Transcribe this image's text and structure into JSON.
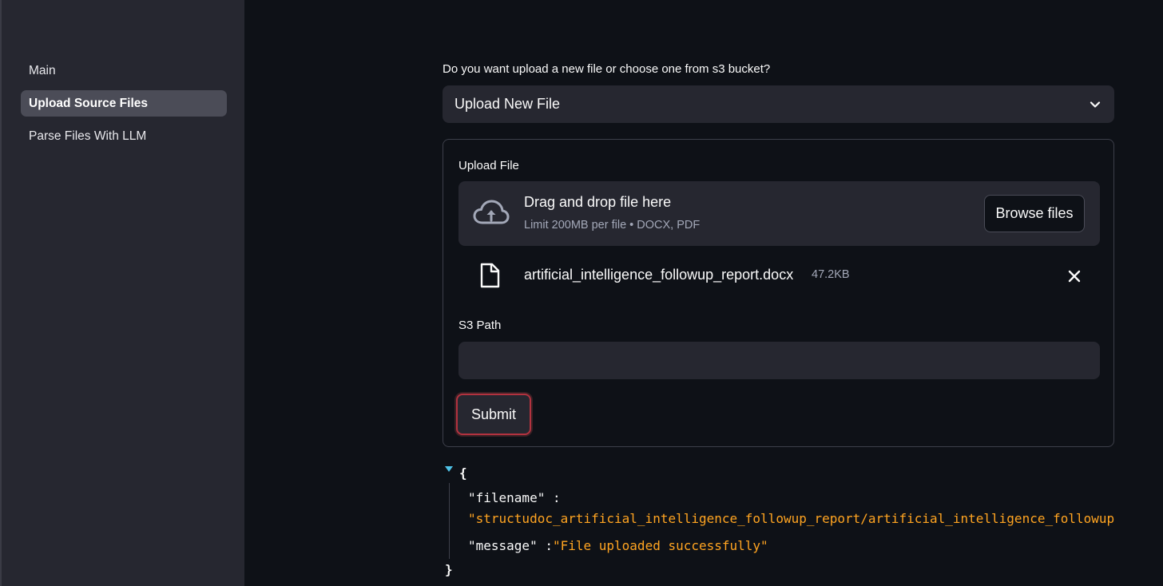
{
  "sidebar": {
    "items": [
      {
        "label": "Main",
        "active": false
      },
      {
        "label": "Upload Source Files",
        "active": true
      },
      {
        "label": "Parse Files With LLM",
        "active": false
      }
    ]
  },
  "main": {
    "question": "Do you want upload a new file or choose one from s3 bucket?",
    "select": {
      "value": "Upload New File",
      "icon": "chevron-down-icon"
    },
    "form": {
      "upload_label": "Upload File",
      "dropzone": {
        "title": "Drag and drop file here",
        "subtitle": "Limit 200MB per file • DOCX, PDF",
        "browse_label": "Browse files",
        "icon": "cloud-upload-icon"
      },
      "file": {
        "name": "artificial_intelligence_followup_report.docx",
        "size": "47.2KB",
        "icon": "file-icon"
      },
      "s3_label": "S3 Path",
      "s3_value": "",
      "submit_label": "Submit"
    },
    "json": {
      "open": "{",
      "close": "}",
      "filename_key": "\"filename\" :",
      "filename_value": "\"structudoc_artificial_intelligence_followup_report/artificial_intelligence_followup_report.docx\"",
      "message_key": "\"message\" :",
      "message_value": "\"File uploaded successfully\""
    }
  },
  "colors": {
    "background": "#0e1117",
    "sidebar": "#262730",
    "accent_border": "#b2323f",
    "json_string": "#ffa421",
    "caret": "#4fc3e8"
  }
}
